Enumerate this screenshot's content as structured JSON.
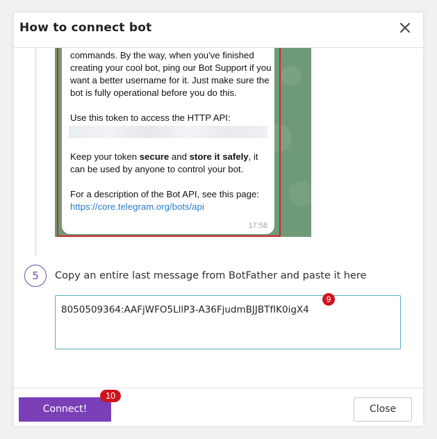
{
  "dialog": {
    "title": "How to connect bot",
    "close_icon": "close-icon"
  },
  "telegram_message": {
    "line1": "profile picture for your bot, see /help for a list of commands. By the way, when you've finished creating your cool bot, ping our Bot Support if you want a better username for it. Just make sure the bot is fully operational before you do this.",
    "token_intro": "Use this token to access the HTTP API:",
    "secure_pre": "Keep your token ",
    "secure_word": "secure",
    "secure_mid": " and ",
    "store_word": "store it safely",
    "secure_post": ", it can be used by anyone to control your bot.",
    "api_intro": "For a description of the Bot API, see this page:",
    "api_link": "https://core.telegram.org/bots/api",
    "time": "17:58"
  },
  "step5": {
    "number": "5",
    "label": "Copy an entire last message from BotFather and paste it here"
  },
  "token_input": {
    "value": "8050509364:AAFjWFO5LllP3-A36FjudmBJJBTfIK0igX4",
    "badge": "9"
  },
  "footer": {
    "connect_label": "Connect!",
    "connect_badge": "10",
    "close_label": "Close"
  },
  "colors": {
    "primary": "#7b3fb8",
    "badge": "#d0141f",
    "input_border": "#5aa9c7",
    "telegram_bg": "#6f9a78",
    "highlight_frame": "#d0232e"
  }
}
